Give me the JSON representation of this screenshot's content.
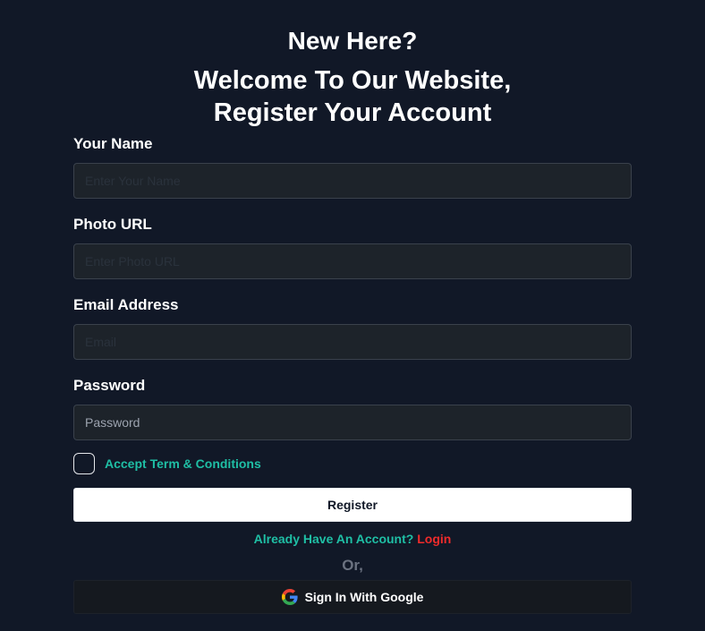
{
  "header": {
    "title": "New Here?",
    "subtitle_line1": "Welcome To Our Website,",
    "subtitle_line2": "Register Your Account"
  },
  "form": {
    "name": {
      "label": "Your Name",
      "placeholder": "Enter Your Name",
      "value": ""
    },
    "photo": {
      "label": "Photo URL",
      "placeholder": "Enter Photo URL",
      "value": ""
    },
    "email": {
      "label": "Email Address",
      "placeholder": "Email",
      "value": ""
    },
    "password": {
      "label": "Password",
      "placeholder": "Password",
      "value": ""
    },
    "terms": {
      "label": "Accept Term & Conditions",
      "checked": false
    },
    "register_label": "Register",
    "already_text": "Already Have An Account?",
    "login_label": "Login",
    "or_text": "Or,",
    "google_label": "Sign In With Google"
  },
  "colors": {
    "background": "#111827",
    "accent_teal": "#1fbfa5",
    "login_red": "#ef2b2b",
    "input_bg": "#1d232a"
  }
}
